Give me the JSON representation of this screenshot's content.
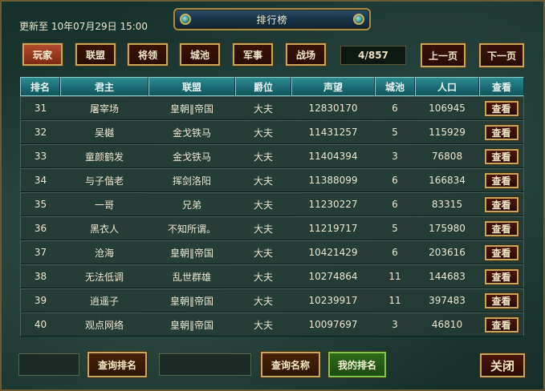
{
  "header": {
    "title": "排行榜",
    "update_time": "更新至 10年07月29日 15:00"
  },
  "tabs": [
    {
      "label": "玩家",
      "active": true
    },
    {
      "label": "联盟",
      "active": false
    },
    {
      "label": "将领",
      "active": false
    },
    {
      "label": "城池",
      "active": false
    },
    {
      "label": "军事",
      "active": false
    },
    {
      "label": "战场",
      "active": false
    }
  ],
  "pagination": {
    "indicator": "4/857",
    "prev_label": "上一页",
    "next_label": "下一页"
  },
  "table": {
    "columns": [
      "排名",
      "君主",
      "联盟",
      "爵位",
      "声望",
      "城池",
      "人口",
      "查看"
    ],
    "view_label": "查看",
    "rows": [
      [
        "31",
        "屠宰场",
        "皇朝‖帝国",
        "大夫",
        "12830170",
        "6",
        "106945"
      ],
      [
        "32",
        "吴樾",
        "金戈铁马",
        "大夫",
        "11431257",
        "5",
        "115929"
      ],
      [
        "33",
        "童颜鹤发",
        "金戈铁马",
        "大夫",
        "11404394",
        "3",
        "76808"
      ],
      [
        "34",
        "与子偕老",
        "挥剑洛阳",
        "大夫",
        "11388099",
        "6",
        "166834"
      ],
      [
        "35",
        "一哥",
        "兄弟",
        "大夫",
        "11230227",
        "6",
        "83315"
      ],
      [
        "36",
        "黑衣人",
        "不知所谓。",
        "大夫",
        "11219717",
        "5",
        "175980"
      ],
      [
        "37",
        "沧海",
        "皇朝‖帝国",
        "大夫",
        "10421429",
        "6",
        "203616"
      ],
      [
        "38",
        "无法低调",
        "乱世群雄",
        "大夫",
        "10274864",
        "11",
        "144683"
      ],
      [
        "39",
        "逍遥子",
        "皇朝‖帝国",
        "大夫",
        "10239917",
        "11",
        "397483"
      ],
      [
        "40",
        "观点网络",
        "皇朝‖帝国",
        "大夫",
        "10097697",
        "3",
        "46810"
      ]
    ]
  },
  "footer": {
    "rank_input_value": "",
    "query_rank_label": "查询排名",
    "name_input_value": "",
    "query_name_label": "查询名称",
    "my_rank_label": "我的排名",
    "close_label": "关闭"
  },
  "colors": {
    "header_teal": "#1b6b74",
    "button_gold_border": "#c7a55a",
    "active_tab": "#b24a2c",
    "green_button": "#2f6a1c"
  }
}
